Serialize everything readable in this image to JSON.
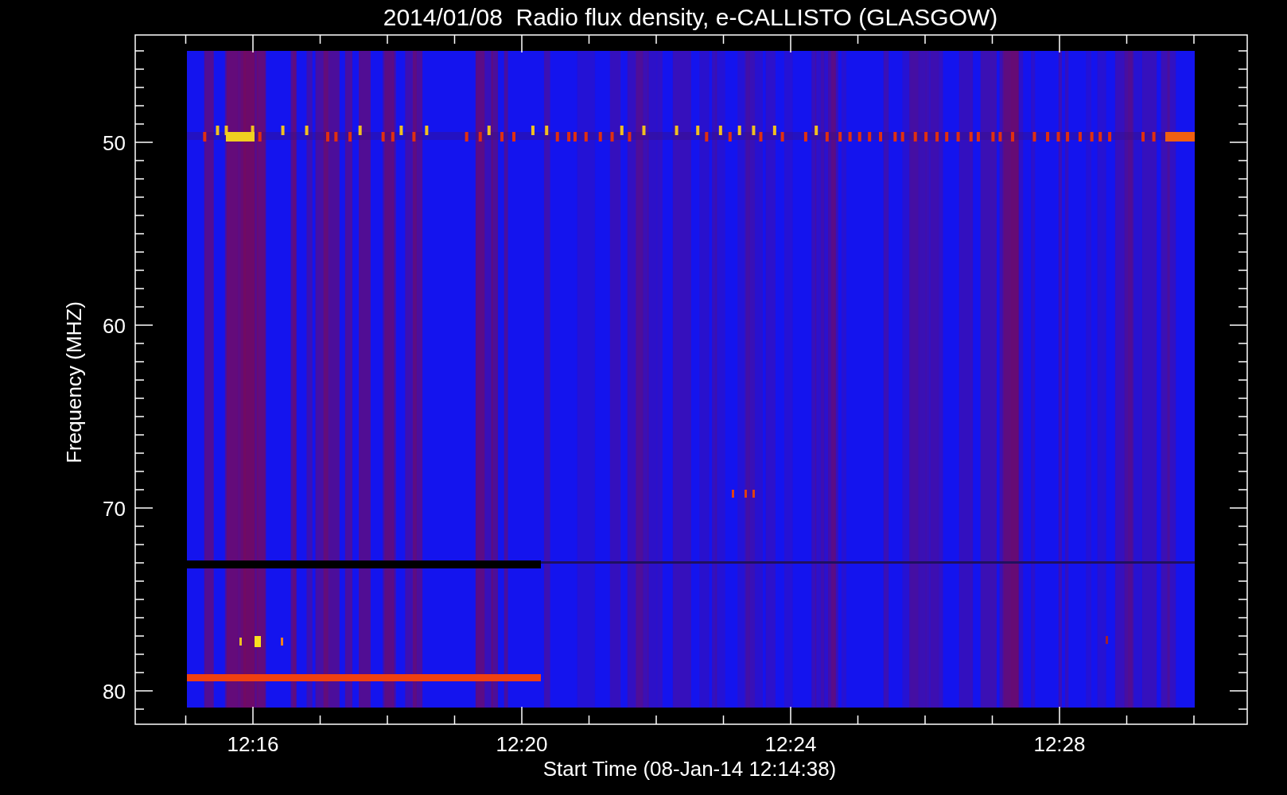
{
  "title": "2014/01/08  Radio flux density, e-CALLISTO (GLASGOW)",
  "y_axis": {
    "label": "Frequency (MHZ)",
    "tick_labels": [
      "50",
      "60",
      "70",
      "80"
    ]
  },
  "x_axis": {
    "label": "Start Time (08-Jan-14 12:14:38)",
    "tick_labels": [
      "12:16",
      "12:20",
      "12:24",
      "12:28"
    ]
  }
}
